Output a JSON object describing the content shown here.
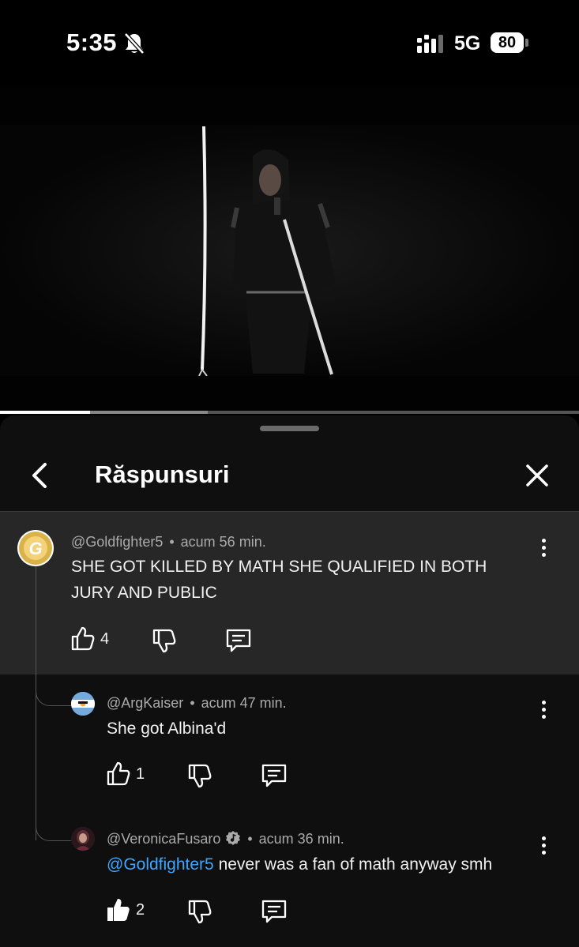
{
  "status_bar": {
    "time": "5:35",
    "network": "5G",
    "battery": "80"
  },
  "video": {
    "progress_fraction": 0.155
  },
  "panel": {
    "title": "Răspunsuri"
  },
  "parent_comment": {
    "author": "@Goldfighter5",
    "time": "acum 56 min.",
    "text": "SHE GOT KILLED BY MATH SHE QUALIFIED IN BOTH JURY AND PUBLIC",
    "likes": "4"
  },
  "replies": [
    {
      "author": "@ArgKaiser",
      "time": "acum 47 min.",
      "text": "She got Albina'd",
      "likes": "1"
    },
    {
      "author": "@VeronicaFusaro",
      "time": "acum 36 min.",
      "mention": "@Goldfighter5",
      "text": " never was a fan of math anyway smh",
      "likes": "2"
    }
  ],
  "separator": "•",
  "icons": [
    "bell-slash-icon",
    "signal-icon",
    "battery-icon",
    "back-icon",
    "close-icon",
    "more-icon",
    "thumb-up-icon",
    "thumb-down-icon",
    "reply-icon",
    "verified-music-icon"
  ]
}
